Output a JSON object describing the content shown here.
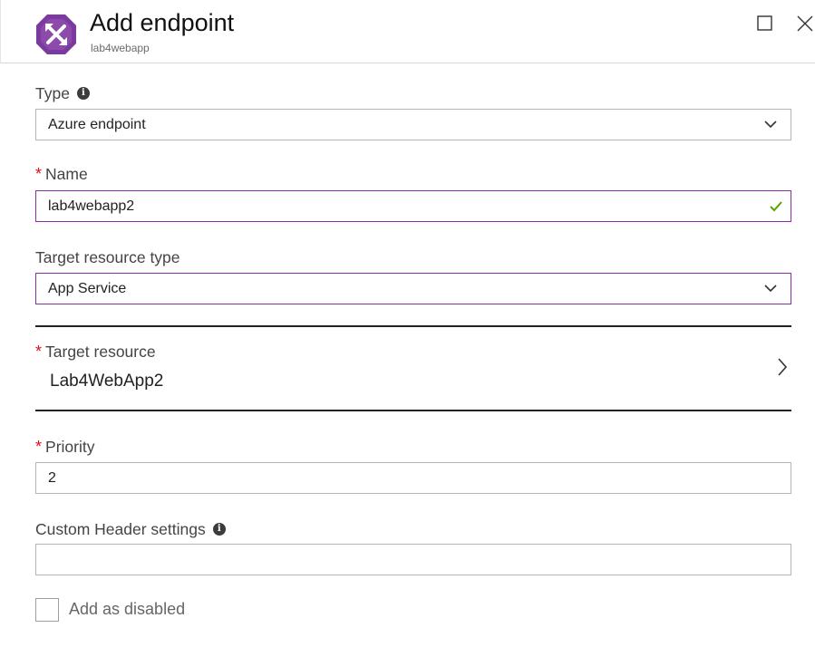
{
  "header": {
    "title": "Add endpoint",
    "subtitle": "lab4webapp",
    "icons": {
      "app": "traffic-manager-icon",
      "maximize": "maximize-icon",
      "close": "close-icon"
    },
    "accent": "#7a3a9e"
  },
  "form": {
    "type": {
      "label": "Type",
      "value": "Azure endpoint"
    },
    "name": {
      "label": "Name",
      "value": "lab4webapp2",
      "valid": true
    },
    "target_resource_type": {
      "label": "Target resource type",
      "value": "App Service"
    },
    "target_resource": {
      "label": "Target resource",
      "value": "Lab4WebApp2"
    },
    "priority": {
      "label": "Priority",
      "value": "2"
    },
    "custom_header": {
      "label": "Custom Header settings",
      "value": ""
    },
    "add_as_disabled": {
      "label": "Add as disabled",
      "checked": false
    }
  },
  "colors": {
    "required": "#e00b1c",
    "focus_border": "#8a2fa1",
    "valid_check": "#57a300"
  }
}
